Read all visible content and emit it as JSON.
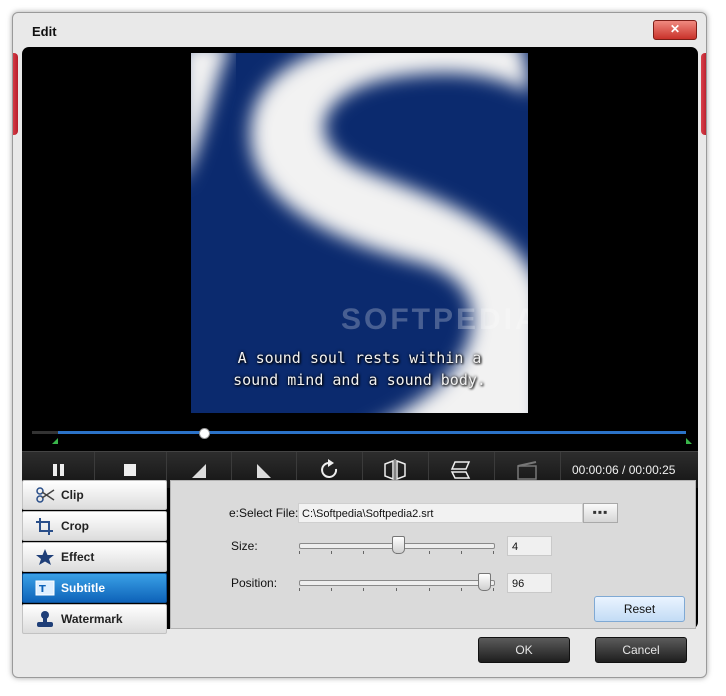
{
  "window": {
    "title": "Edit",
    "close_glyph": "✕"
  },
  "video": {
    "subtitle_lines": [
      "A sound soul rests within a",
      "sound mind and a sound body."
    ],
    "watermark": "SOFTPEDIA"
  },
  "player": {
    "time_current": "00:00:06",
    "time_total": "00:00:25",
    "time_display": "00:00:06 / 00:00:25"
  },
  "tabs": [
    {
      "label": "Clip",
      "icon": "scissors-icon"
    },
    {
      "label": "Crop",
      "icon": "crop-icon"
    },
    {
      "label": "Effect",
      "icon": "star-icon"
    },
    {
      "label": "Subtitle",
      "icon": "subtitle-icon",
      "active": true
    },
    {
      "label": "Watermark",
      "icon": "stamp-icon"
    }
  ],
  "subtitle": {
    "select_file_label": "e:Select File:",
    "file_path": "C:\\Softpedia\\Softpedia2.srt",
    "browse_label": "▪▪▪",
    "size_label": "Size:",
    "size_value": "4",
    "position_label": "Position:",
    "position_value": "96",
    "reset_label": "Reset"
  },
  "footer": {
    "ok_label": "OK",
    "cancel_label": "Cancel"
  },
  "colors": {
    "accent": "#2b72c7",
    "active_tab": "#1a78cf",
    "close": "#c9322a"
  }
}
